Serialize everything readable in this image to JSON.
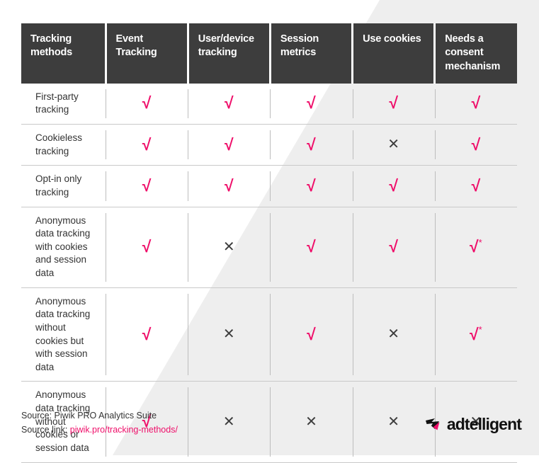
{
  "table": {
    "columns": [
      {
        "id": "tracking-methods",
        "label": "Tracking methods"
      },
      {
        "id": "event-tracking",
        "label": "Event Tracking"
      },
      {
        "id": "user-device-tracking",
        "label": "User/device tracking"
      },
      {
        "id": "session-metrics",
        "label": "Session metrics"
      },
      {
        "id": "use-cookies",
        "label": "Use cookies"
      },
      {
        "id": "needs-consent-mechanism",
        "label": "Needs a consent mechanism"
      }
    ],
    "rows": [
      {
        "label": "First-party tracking",
        "cells": [
          {
            "mark": "yes",
            "glyph": "√",
            "note": ""
          },
          {
            "mark": "yes",
            "glyph": "√",
            "note": ""
          },
          {
            "mark": "yes",
            "glyph": "√",
            "note": ""
          },
          {
            "mark": "yes",
            "glyph": "√",
            "note": ""
          },
          {
            "mark": "yes",
            "glyph": "√",
            "note": ""
          }
        ]
      },
      {
        "label": "Cookieless tracking",
        "cells": [
          {
            "mark": "yes",
            "glyph": "√",
            "note": ""
          },
          {
            "mark": "yes",
            "glyph": "√",
            "note": ""
          },
          {
            "mark": "yes",
            "glyph": "√",
            "note": ""
          },
          {
            "mark": "no",
            "glyph": "✕",
            "note": ""
          },
          {
            "mark": "yes",
            "glyph": "√",
            "note": ""
          }
        ]
      },
      {
        "label": "Opt-in only tracking",
        "cells": [
          {
            "mark": "yes",
            "glyph": "√",
            "note": ""
          },
          {
            "mark": "yes",
            "glyph": "√",
            "note": ""
          },
          {
            "mark": "yes",
            "glyph": "√",
            "note": ""
          },
          {
            "mark": "yes",
            "glyph": "√",
            "note": ""
          },
          {
            "mark": "yes",
            "glyph": "√",
            "note": ""
          }
        ]
      },
      {
        "label": "Anonymous data tracking with cookies and session data",
        "cells": [
          {
            "mark": "yes",
            "glyph": "√",
            "note": ""
          },
          {
            "mark": "no",
            "glyph": "✕",
            "note": ""
          },
          {
            "mark": "yes",
            "glyph": "√",
            "note": ""
          },
          {
            "mark": "yes",
            "glyph": "√",
            "note": ""
          },
          {
            "mark": "yes",
            "glyph": "√",
            "note": "*"
          }
        ]
      },
      {
        "label": "Anonymous data tracking without cookies but with session data",
        "cells": [
          {
            "mark": "yes",
            "glyph": "√",
            "note": ""
          },
          {
            "mark": "no",
            "glyph": "✕",
            "note": ""
          },
          {
            "mark": "yes",
            "glyph": "√",
            "note": ""
          },
          {
            "mark": "no",
            "glyph": "✕",
            "note": ""
          },
          {
            "mark": "yes",
            "glyph": "√",
            "note": "*"
          }
        ]
      },
      {
        "label": "Anonymous data tracking without cookies or session data",
        "cells": [
          {
            "mark": "yes",
            "glyph": "√",
            "note": ""
          },
          {
            "mark": "no",
            "glyph": "✕",
            "note": ""
          },
          {
            "mark": "no",
            "glyph": "✕",
            "note": ""
          },
          {
            "mark": "no",
            "glyph": "✕",
            "note": ""
          },
          {
            "mark": "no",
            "glyph": "✕",
            "note": ""
          }
        ]
      }
    ]
  },
  "footer": {
    "source_line": "Source: Piwik PRO Analytics Suite",
    "source_link_prefix": "Source link: ",
    "source_link_text": "piwik.pro/tracking-methods/"
  },
  "brand": {
    "wordmark": "adtelligent"
  },
  "colors": {
    "accent_pink": "#ef0f6a",
    "header_dark": "#3d3d3d",
    "shadow_gray": "#eeeeee",
    "text_dark": "#333333",
    "rule_gray": "#c9c9c9"
  }
}
